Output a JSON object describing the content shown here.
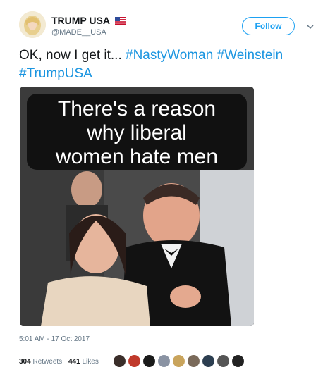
{
  "header": {
    "display_name": "TRUMP USA",
    "handle": "@MADE__USA",
    "follow_label": "Follow"
  },
  "tweet": {
    "text_plain": "OK, now I get it... ",
    "hashtags": [
      "#NastyWoman",
      "#Weinstein",
      "#TrumpUSA"
    ],
    "image_caption_lines": [
      "There's a reason",
      "why liberal",
      "women hate men"
    ],
    "timestamp": "5:01 AM - 17 Oct 2017"
  },
  "stats": {
    "retweets_count": "304",
    "retweets_label": "Retweets",
    "likes_count": "441",
    "likes_label": "Likes"
  },
  "likers": [
    {
      "name": "liker-1",
      "color": "#3a2e2a"
    },
    {
      "name": "liker-2",
      "color": "#c0392b"
    },
    {
      "name": "liker-3",
      "color": "#1a1a1a"
    },
    {
      "name": "liker-4",
      "color": "#8a93a3"
    },
    {
      "name": "liker-5",
      "color": "#c9a45c"
    },
    {
      "name": "liker-6",
      "color": "#7a6a5a"
    },
    {
      "name": "liker-7",
      "color": "#2c3e50"
    },
    {
      "name": "liker-8",
      "color": "#555555"
    },
    {
      "name": "liker-9",
      "color": "#222222"
    }
  ],
  "colors": {
    "accent": "#1da1f2",
    "hashtag": "#1b95e0",
    "muted": "#657786",
    "text": "#14171a"
  }
}
